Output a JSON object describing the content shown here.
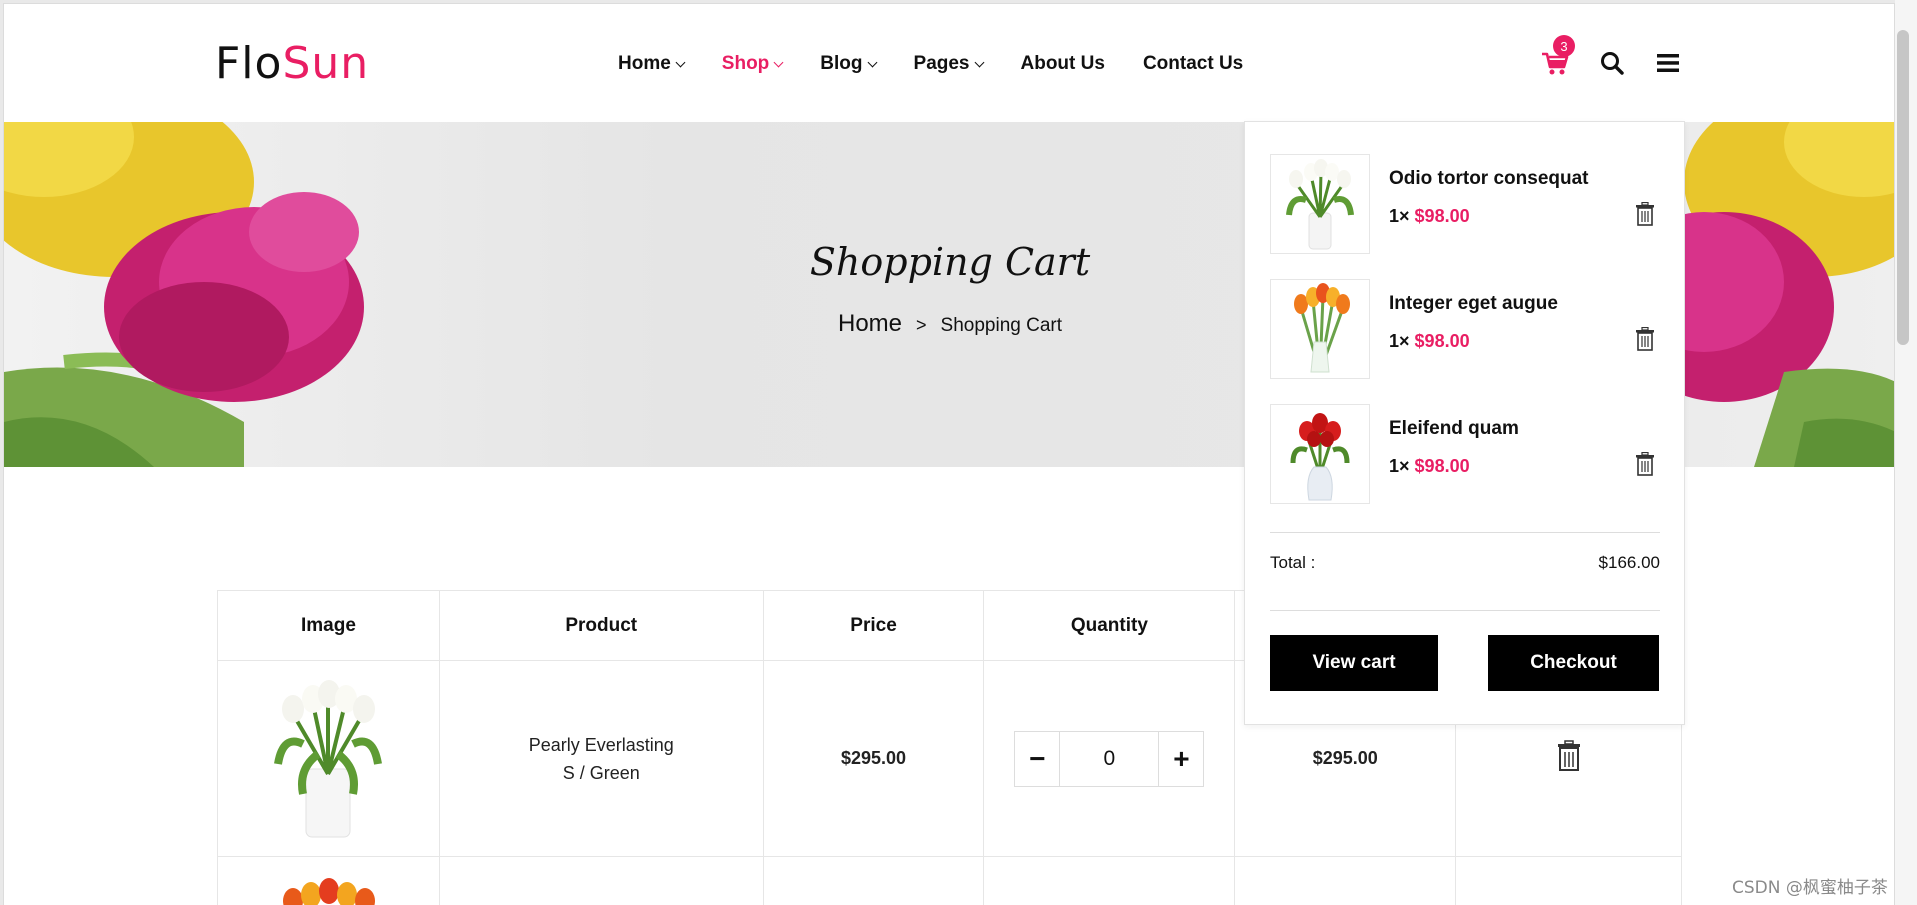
{
  "brand": {
    "part1": "Flo",
    "part2": "Sun"
  },
  "nav": {
    "items": [
      {
        "label": "Home",
        "has_dropdown": true,
        "active": false
      },
      {
        "label": "Shop",
        "has_dropdown": true,
        "active": true
      },
      {
        "label": "Blog",
        "has_dropdown": true,
        "active": false
      },
      {
        "label": "Pages",
        "has_dropdown": true,
        "active": false
      },
      {
        "label": "About Us",
        "has_dropdown": false,
        "active": false
      },
      {
        "label": "Contact Us",
        "has_dropdown": false,
        "active": false
      }
    ]
  },
  "header_icons": {
    "cart": "cart-icon",
    "cart_count": "3",
    "search": "search-icon",
    "menu": "hamburger-menu-icon"
  },
  "banner": {
    "title": "Shopping Cart",
    "breadcrumb": {
      "home": "Home",
      "separator": ">",
      "current": "Shopping Cart"
    }
  },
  "cart_table": {
    "headers": [
      "Image",
      "Product",
      "Price",
      "Quantity"
    ],
    "rows": [
      {
        "product_line1": "Pearly Everlasting",
        "product_line2": "S / Green",
        "price": "$295.00",
        "quantity": "0",
        "total": "$295.00"
      }
    ]
  },
  "mini_cart": {
    "items": [
      {
        "name": "Odio tortor consequat",
        "qty": "1×",
        "price": "$98.00"
      },
      {
        "name": "Integer eget augue",
        "qty": "1×",
        "price": "$98.00"
      },
      {
        "name": "Eleifend quam",
        "qty": "1×",
        "price": "$98.00"
      }
    ],
    "total_label": "Total :",
    "total_value": "$166.00",
    "view_cart_label": "View cart",
    "checkout_label": "Checkout"
  },
  "colors": {
    "accent": "#e91e63",
    "button_bg": "#000000"
  },
  "watermark": "CSDN @枫蜜柚子茶"
}
